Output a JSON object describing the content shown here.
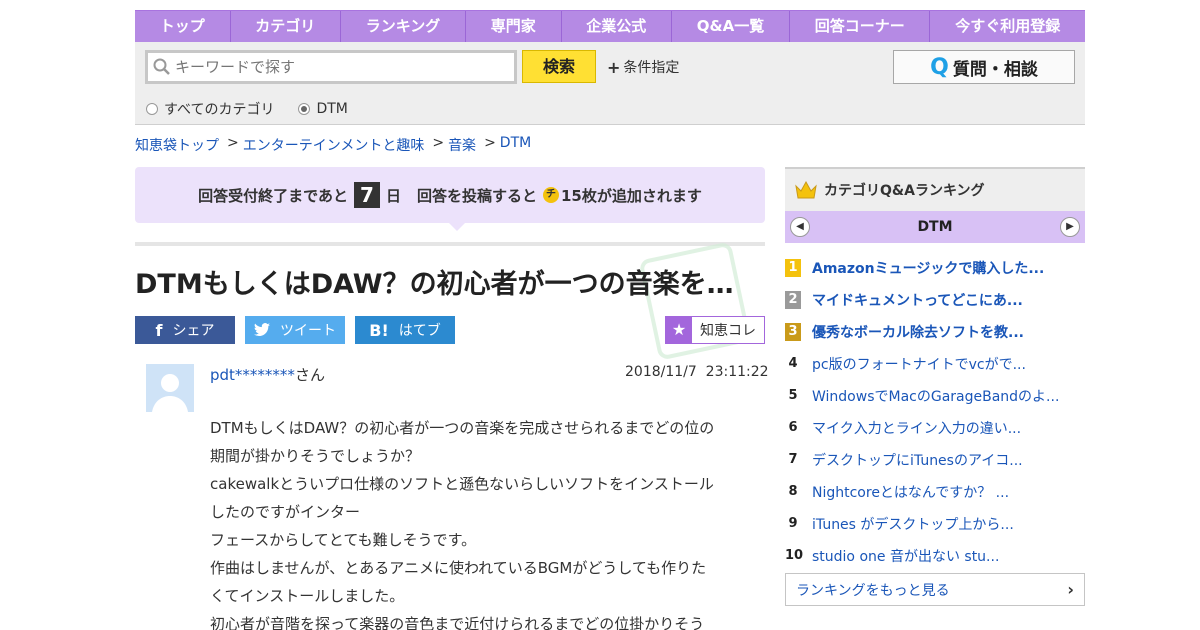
{
  "nav": [
    "トップ",
    "カテゴリ",
    "ランキング",
    "専門家",
    "企業公式",
    "Q&A一覧",
    "回答コーナー",
    "今すぐ利用登録"
  ],
  "search": {
    "placeholder": "キーワードで探す",
    "button": "検索",
    "conditions": "条件指定",
    "ask_button": "質問・相談",
    "radios": [
      {
        "label": "すべてのカテゴリ",
        "selected": false
      },
      {
        "label": "DTM",
        "selected": true
      }
    ]
  },
  "breadcrumb": [
    "知恵袋トップ",
    "エンターテインメントと趣味",
    "音楽",
    "DTM"
  ],
  "breadcrumb_sep": ">",
  "notice": {
    "prefix": "回答受付終了まであと",
    "days": "7",
    "days_unit": "日",
    "middle": "回答を投稿すると",
    "coin": "チ",
    "suffix": "15枚が追加されます"
  },
  "question": {
    "title": "DTMもしくはDAW？の初心者が一つの音楽を完成させられるまでどの位の期間が掛かりそうでしょうか？",
    "user": "pdt********",
    "user_suffix": "さん",
    "date": "2018/11/7  23:11:22",
    "body": [
      "DTMもしくはDAW？の初心者が一つの音楽を完成させられるまでどの位の",
      "期間が掛かりそうでしょうか？",
      "cakewalkとういプロ仕様のソフトと遜色ないらしいソフトをインストール",
      "したのですがインター",
      "フェースからしてとても難しそうです。",
      "作曲はしませんが、とあるアニメに使われているBGMがどうしても作りた",
      "くてインストールしました。",
      "初心者が音階を探って楽器の音色まで近付けられるまでどの位掛かりそう"
    ]
  },
  "share": {
    "facebook": "シェア",
    "twitter": "ツイート",
    "hatena": "はてブ",
    "chiekore": "知恵コレ"
  },
  "ranking": {
    "title": "カテゴリQ&Aランキング",
    "category": "DTM",
    "items": [
      {
        "rank": "1",
        "text": "Amazonミュージックで購入した..."
      },
      {
        "rank": "2",
        "text": "マイドキュメントってどこにあ..."
      },
      {
        "rank": "3",
        "text": "優秀なボーカル除去ソフトを教..."
      },
      {
        "rank": "4",
        "text": "pc版のフォートナイトでvcがで..."
      },
      {
        "rank": "5",
        "text": "WindowsでMacのGarageBandのよ..."
      },
      {
        "rank": "6",
        "text": "マイク入力とライン入力の違い..."
      },
      {
        "rank": "7",
        "text": "デスクトップにiTunesのアイコ..."
      },
      {
        "rank": "8",
        "text": "Nightcoreとはなんですか？ ..."
      },
      {
        "rank": "9",
        "text": "iTunes がデスクトップ上から..."
      },
      {
        "rank": "10",
        "text": "studio one 音が出ない stu..."
      }
    ],
    "more": "ランキングをもっと見る"
  },
  "colors": {
    "nav": "#b58ae4",
    "link": "#1a56b8",
    "search_button": "#ffe033",
    "notice_bg": "#ece2fb"
  }
}
